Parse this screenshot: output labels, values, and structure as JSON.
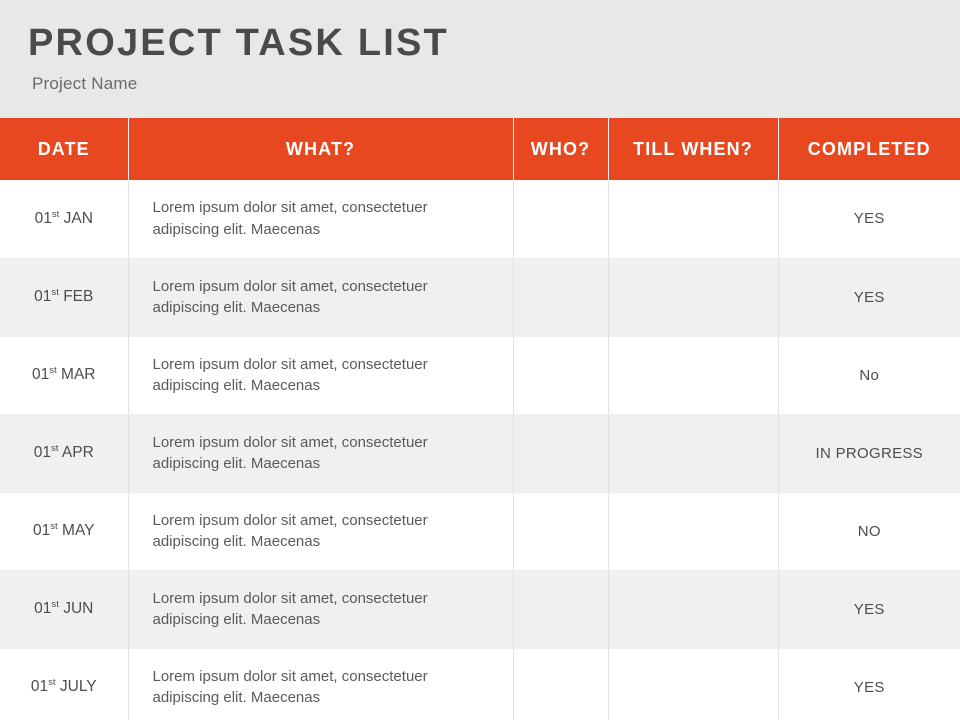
{
  "header": {
    "title": "PROJECT TASK LIST",
    "subtitle": "Project Name",
    "banner_bg": "#E8E8E8",
    "title_color": "#4A4A4A"
  },
  "table": {
    "accent_color": "#E8481F",
    "row_alt_color": "#F0F0F0",
    "columns": [
      {
        "key": "date",
        "label": "DATE"
      },
      {
        "key": "what",
        "label": "WHAT?"
      },
      {
        "key": "who",
        "label": "WHO?"
      },
      {
        "key": "till_when",
        "label": "TILL WHEN?"
      },
      {
        "key": "completed",
        "label": "COMPLETED"
      }
    ],
    "rows": [
      {
        "date_day": "01",
        "date_suffix": "st",
        "date_month": "JAN",
        "what": "Lorem ipsum dolor sit amet, consectetuer adipiscing elit. Maecenas",
        "who": "",
        "till_when": "",
        "completed": "YES"
      },
      {
        "date_day": "01",
        "date_suffix": "st",
        "date_month": "FEB",
        "what": "Lorem ipsum dolor sit amet, consectetuer adipiscing elit. Maecenas",
        "who": "",
        "till_when": "",
        "completed": "YES"
      },
      {
        "date_day": "01",
        "date_suffix": "st",
        "date_month": "MAR",
        "what": "Lorem ipsum dolor sit amet, consectetuer adipiscing elit. Maecenas",
        "who": "",
        "till_when": "",
        "completed": "No"
      },
      {
        "date_day": "01",
        "date_suffix": "st",
        "date_month": "APR",
        "what": "Lorem ipsum dolor sit amet, consectetuer adipiscing elit. Maecenas",
        "who": "",
        "till_when": "",
        "completed": "IN PROGRESS"
      },
      {
        "date_day": "01",
        "date_suffix": "st",
        "date_month": "MAY",
        "what": "Lorem ipsum dolor sit amet, consectetuer adipiscing elit. Maecenas",
        "who": "",
        "till_when": "",
        "completed": "NO"
      },
      {
        "date_day": "01",
        "date_suffix": "st",
        "date_month": "JUN",
        "what": "Lorem ipsum dolor sit amet, consectetuer adipiscing elit. Maecenas",
        "who": "",
        "till_when": "",
        "completed": "YES"
      },
      {
        "date_day": "01",
        "date_suffix": "st",
        "date_month": "JULY",
        "what": "Lorem ipsum dolor sit amet, consectetuer adipiscing elit. Maecenas",
        "who": "",
        "till_when": "",
        "completed": "YES"
      }
    ]
  }
}
